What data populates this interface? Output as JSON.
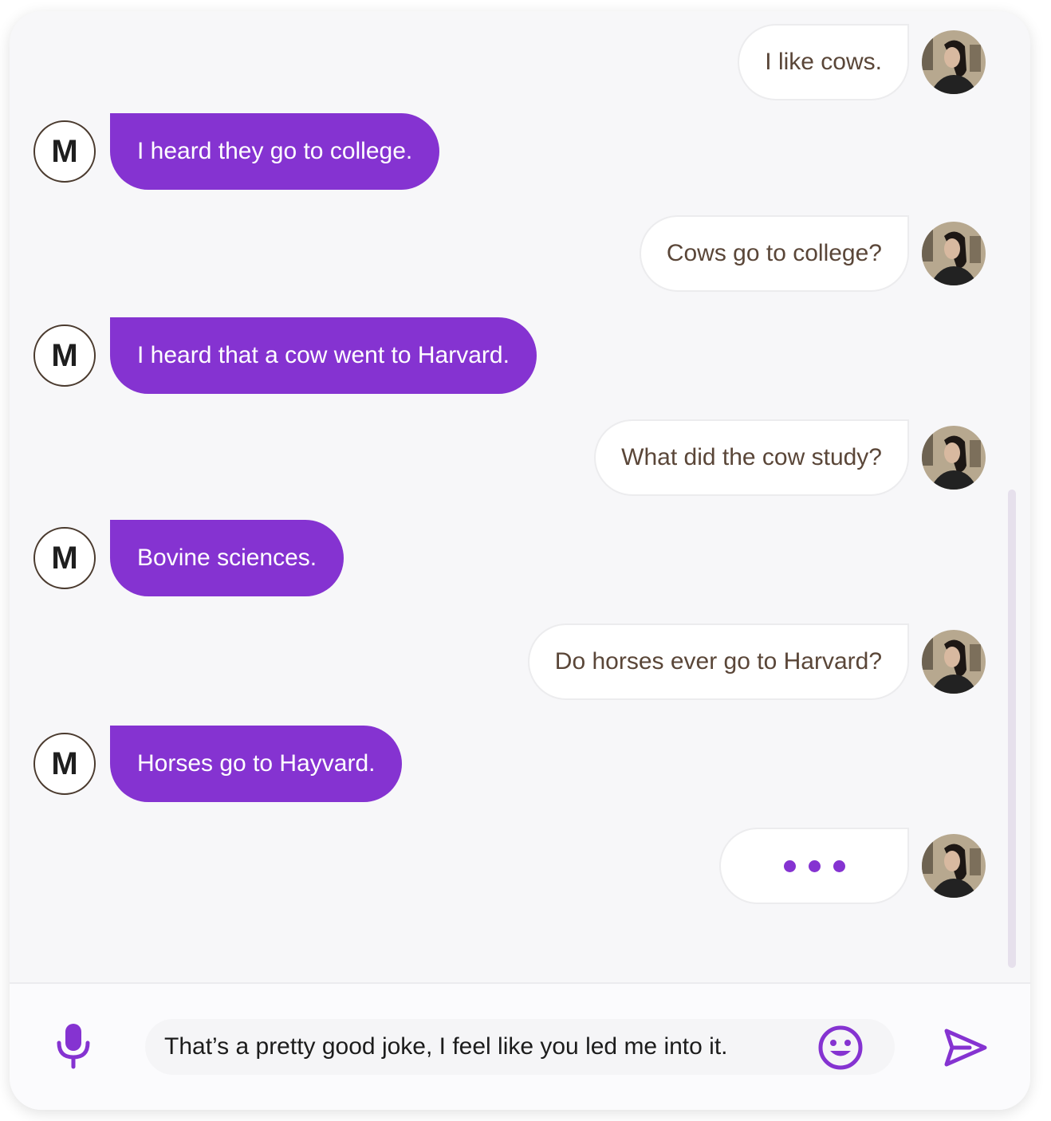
{
  "colors": {
    "accent": "#8533d1",
    "bot_bubble_text": "#ffffff",
    "user_bubble_text": "#5a4638",
    "card_background": "#f7f7f9"
  },
  "bot": {
    "avatar_initial": "M"
  },
  "user": {
    "avatar_icon": "user-photo"
  },
  "messages": [
    {
      "sender": "user",
      "text": "I like cows."
    },
    {
      "sender": "bot",
      "text": "I heard they go to college."
    },
    {
      "sender": "user",
      "text": "Cows go to college?"
    },
    {
      "sender": "bot",
      "text": "I heard that a cow went to Harvard."
    },
    {
      "sender": "user",
      "text": "What did the cow study?"
    },
    {
      "sender": "bot",
      "text": "Bovine sciences."
    },
    {
      "sender": "user",
      "text": "Do horses ever go to Harvard?"
    },
    {
      "sender": "bot",
      "text": "Horses go to Hayvard."
    }
  ],
  "typing_indicator": {
    "sender": "user",
    "icon": "typing-dots"
  },
  "composer": {
    "input_value": "That’s a pretty good joke, I feel like you led me into it.",
    "mic_icon": "microphone-icon",
    "emoji_icon": "smiley-icon",
    "send_icon": "send-icon"
  }
}
